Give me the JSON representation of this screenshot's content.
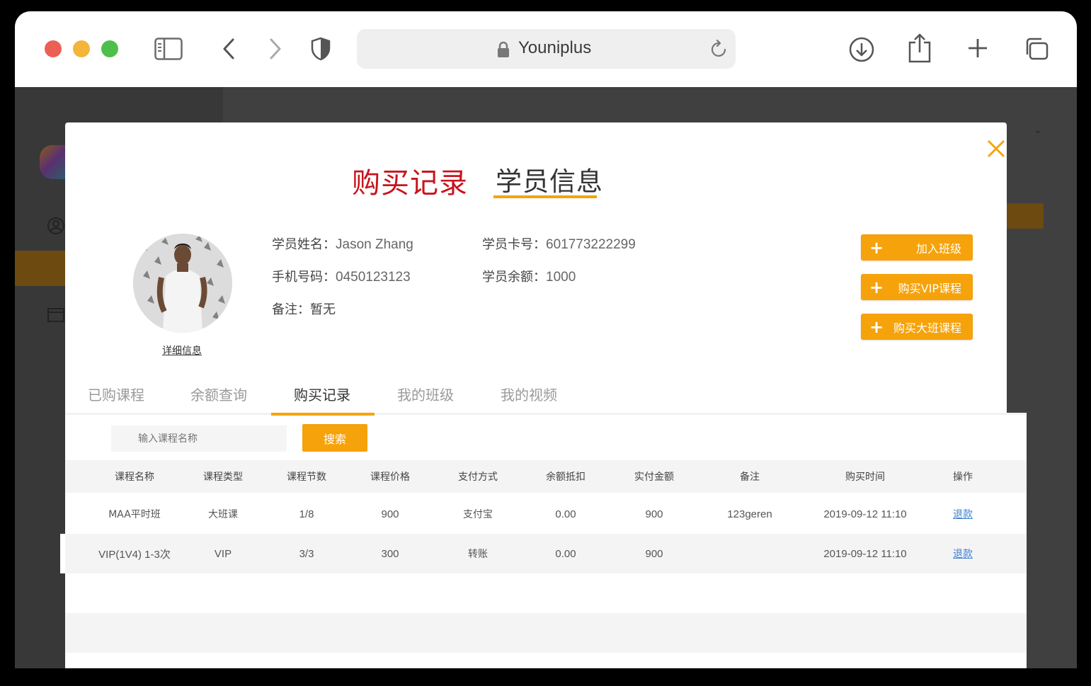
{
  "browser": {
    "url_text": "Youniplus"
  },
  "modal": {
    "title_active": "购买记录",
    "title_inactive": "学员信息",
    "detail_link": "详细信息",
    "student": {
      "name_label": "学员姓名：",
      "name": "Jason Zhang",
      "card_label": "学员卡号：",
      "card": "601773222299",
      "phone_label": "手机号码：",
      "phone": "0450123123",
      "balance_label": "学员余额：",
      "balance": "1000",
      "note_label": "备注：",
      "note": "暂无"
    },
    "actions": {
      "join_class": "加入班级",
      "buy_vip": "购买VIP课程",
      "buy_big_class": "购买大班课程"
    },
    "tabs": [
      "已购课程",
      "余额查询",
      "购买记录",
      "我的班级",
      "我的视频"
    ],
    "search": {
      "placeholder": "输入课程名称",
      "button": "搜索"
    },
    "table": {
      "headers": [
        "课程名称",
        "课程类型",
        "课程节数",
        "课程价格",
        "支付方式",
        "余额抵扣",
        "实付金额",
        "备注",
        "购买时间",
        "操作"
      ],
      "rows": [
        [
          "MAA平时班",
          "大班课",
          "1/8",
          "900",
          "支付宝",
          "0.00",
          "900",
          "123geren",
          "2019-09-12 11:10",
          "退款"
        ],
        [
          "VIP(1V4) 1-3次",
          "VIP",
          "3/3",
          "300",
          "转账",
          "0.00",
          "900",
          "",
          "2019-09-12 11:10",
          "退款"
        ]
      ]
    }
  },
  "colors": {
    "accent": "#f6a20a",
    "title_red": "#c8141e",
    "link_blue": "#3b7fd6"
  }
}
